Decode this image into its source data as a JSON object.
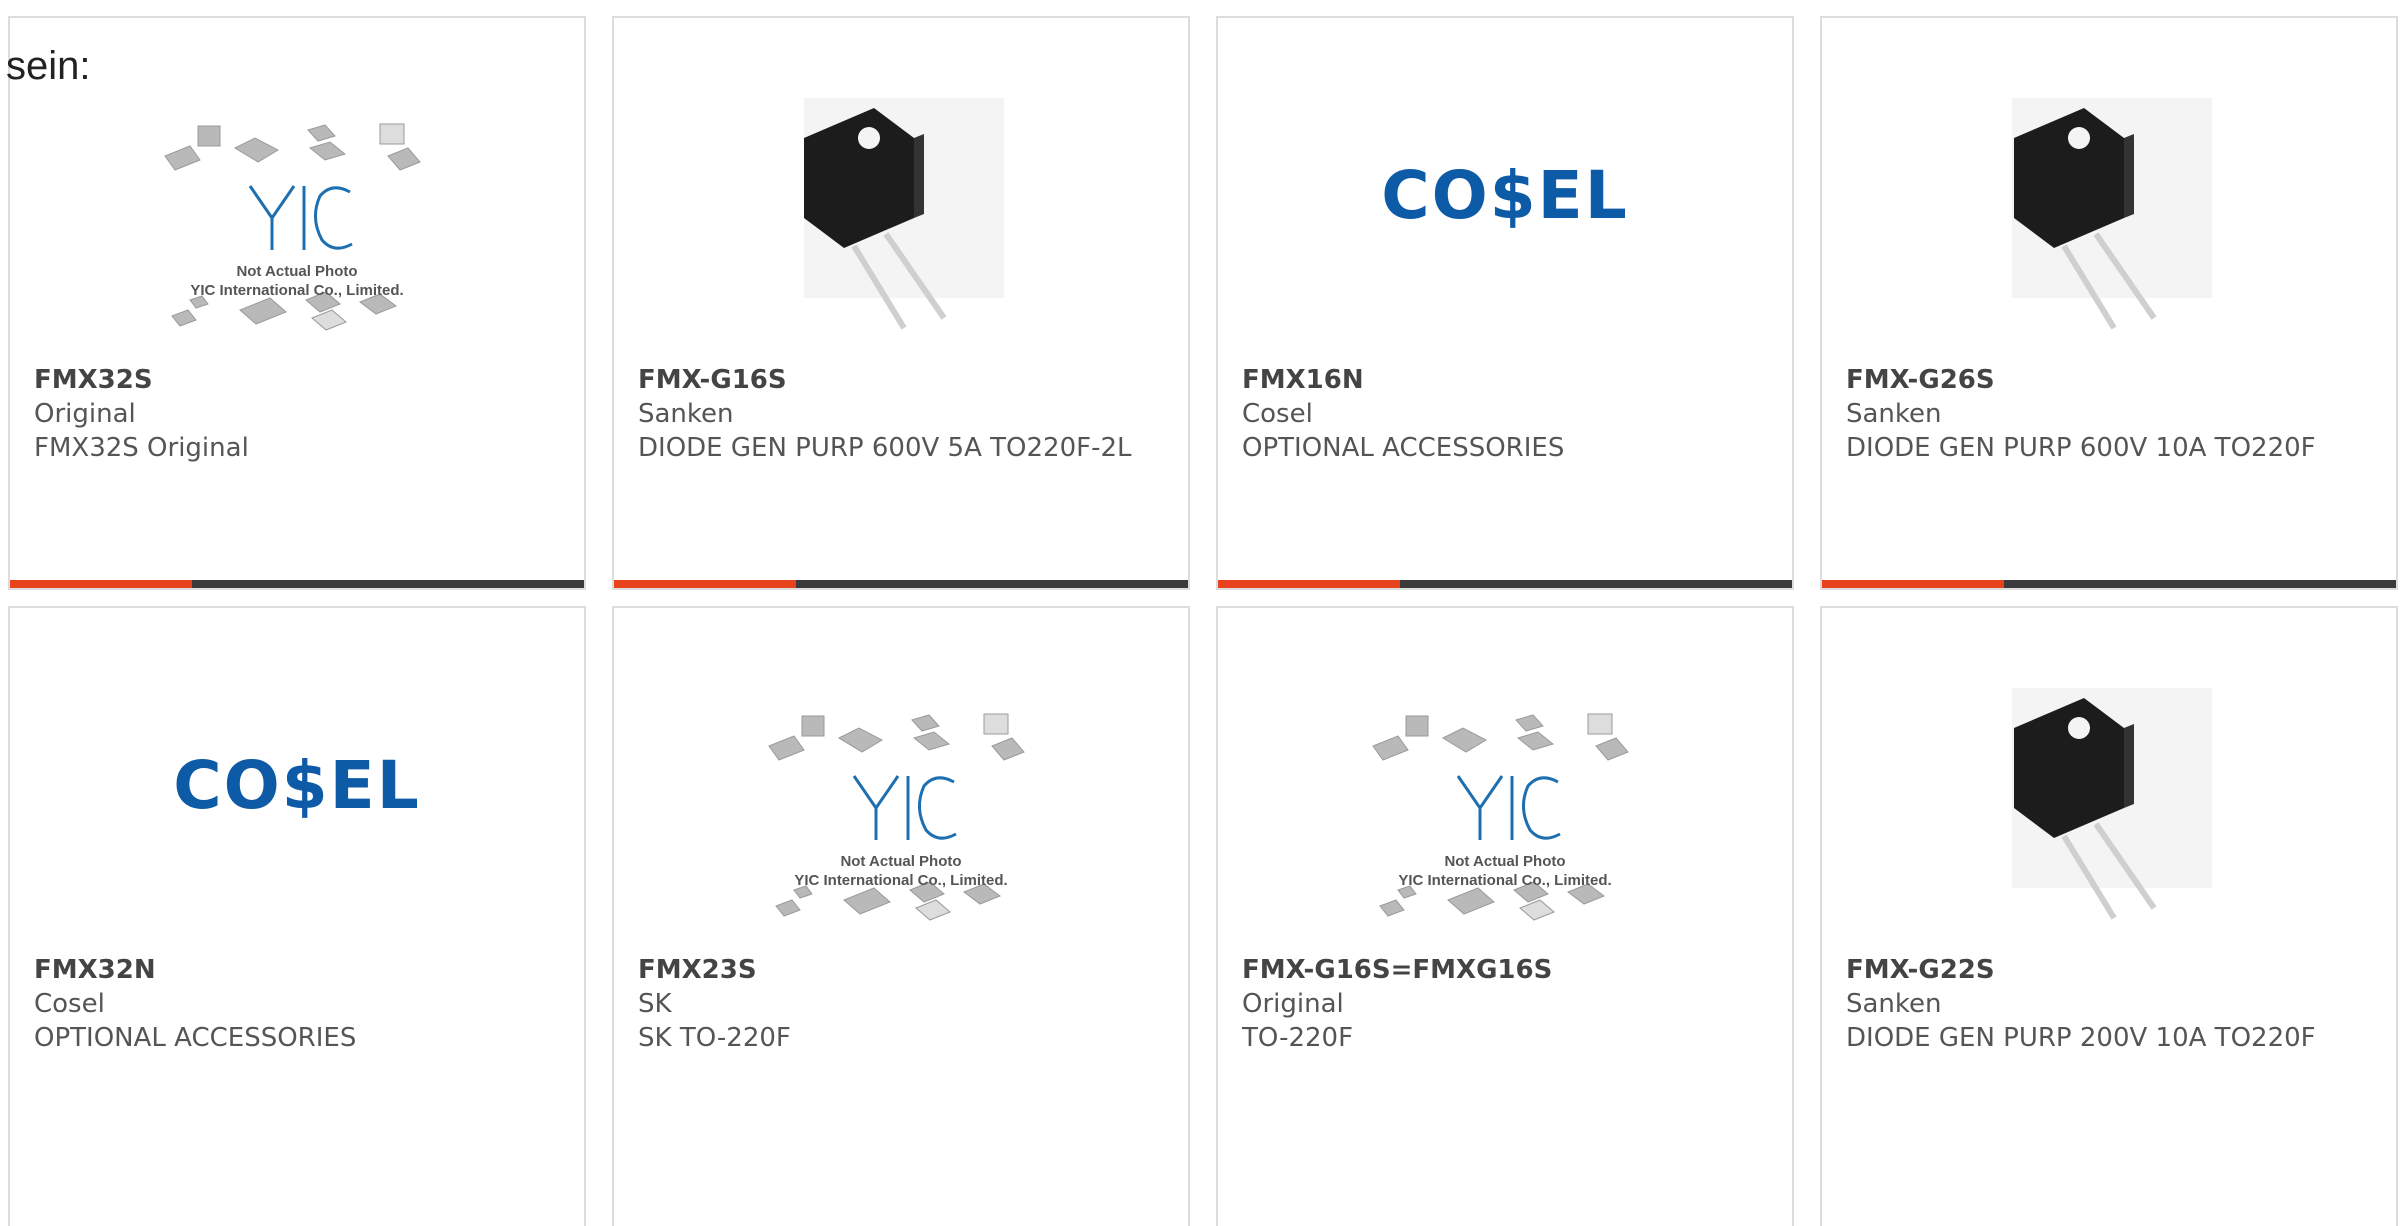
{
  "intro": {
    "text": "sein:"
  },
  "colors": {
    "accent": "#e8431f",
    "bar": "#3a3a3a",
    "cosel_blue": "#0d5aa7",
    "yic_blue": "#1e6fb0"
  },
  "products": [
    {
      "part": "FMX32S",
      "maker": "Original",
      "desc": "FMX32S Original",
      "image": "yic-placeholder",
      "yic_line1": "Not Actual Photo",
      "yic_line2": "YIC International Co., Limited."
    },
    {
      "part": "FMX-G16S",
      "maker": "Sanken",
      "desc": "DIODE GEN PURP 600V 5A TO220F-2L",
      "image": "to220-diode-photo"
    },
    {
      "part": "FMX16N",
      "maker": "Cosel",
      "desc": "OPTIONAL ACCESSORIES",
      "image": "cosel-logo",
      "logo_text": "CO$EL"
    },
    {
      "part": "FMX-G26S",
      "maker": "Sanken",
      "desc": "DIODE GEN PURP 600V 10A TO220F",
      "image": "to220-diode-photo"
    },
    {
      "part": "FMX32N",
      "maker": "Cosel",
      "desc": "OPTIONAL ACCESSORIES",
      "image": "cosel-logo",
      "logo_text": "CO$EL"
    },
    {
      "part": "FMX23S",
      "maker": "SK",
      "desc": "SK TO-220F",
      "image": "yic-placeholder",
      "yic_line1": "Not Actual Photo",
      "yic_line2": "YIC International Co., Limited."
    },
    {
      "part": "FMX-G16S=FMXG16S",
      "maker": "Original",
      "desc": "TO-220F",
      "image": "yic-placeholder",
      "yic_line1": "Not Actual Photo",
      "yic_line2": "YIC International Co., Limited."
    },
    {
      "part": "FMX-G22S",
      "maker": "Sanken",
      "desc": "DIODE GEN PURP 200V 10A TO220F",
      "image": "to220-diode-photo"
    }
  ]
}
